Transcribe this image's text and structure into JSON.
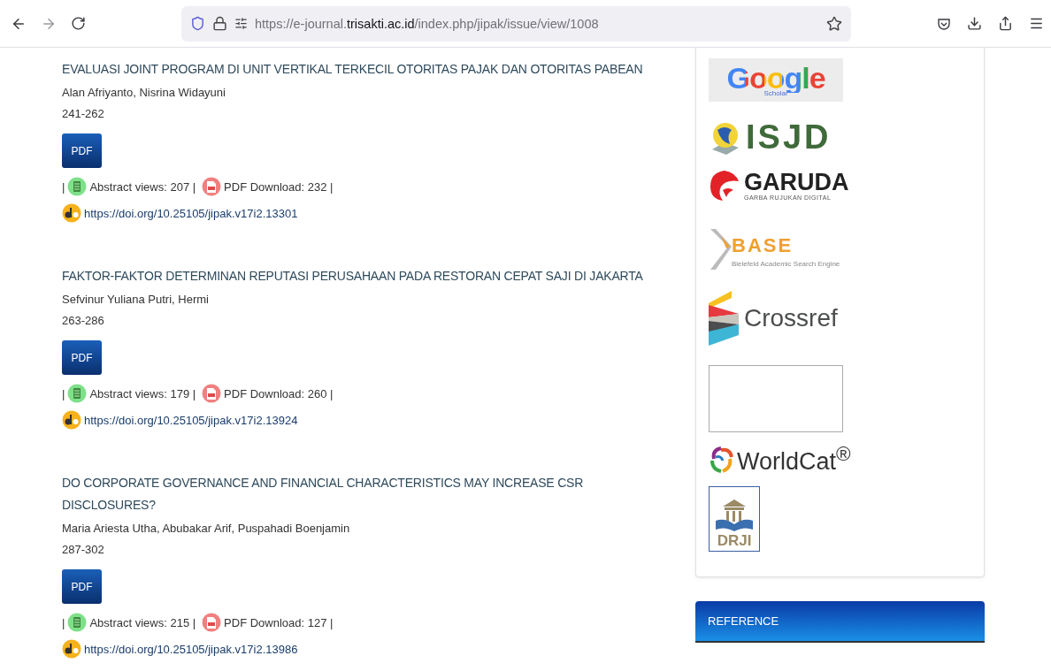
{
  "browser": {
    "url_segments": [
      {
        "text": "https://e-journal.",
        "emphasis": false
      },
      {
        "text": "trisakti.ac.id",
        "emphasis": true
      },
      {
        "text": "/index.php/jipak/issue/view/1008",
        "emphasis": false
      }
    ]
  },
  "articles": [
    {
      "title": "EVALUASI JOINT PROGRAM DI UNIT VERTIKAL TERKECIL OTORITAS PAJAK DAN OTORITAS PABEAN",
      "authors": "Alan Afriyanto, Nisrina Widayuni",
      "pages": "241-262",
      "galley": "PDF",
      "stats_lead": "|",
      "abstract_views": "Abstract views: 207 |",
      "pdf_downloads": "PDF Download: 232 |",
      "doi": "https://doi.org/10.25105/jipak.v17i2.13301"
    },
    {
      "title": "FAKTOR-FAKTOR DETERMINAN REPUTASI PERUSAHAAN PADA RESTORAN CEPAT SAJI DI JAKARTA",
      "authors": "Sefvinur Yuliana Putri, Hermi",
      "pages": "263-286",
      "galley": "PDF",
      "stats_lead": "|",
      "abstract_views": "Abstract views: 179 |",
      "pdf_downloads": "PDF Download: 260 |",
      "doi": "https://doi.org/10.25105/jipak.v17i2.13924"
    },
    {
      "title": "DO CORPORATE GOVERNANCE AND FINANCIAL CHARACTERISTICS MAY INCREASE CSR DISCLOSURES?",
      "authors": "Maria Ariesta Utha, Abubakar Arif, Puspahadi Boenjamin",
      "pages": "287-302",
      "galley": "PDF",
      "stats_lead": "|",
      "abstract_views": "Abstract views: 215 |",
      "pdf_downloads": "PDF Download: 127 |",
      "doi": "https://doi.org/10.25105/jipak.v17i2.13986"
    }
  ],
  "sidebar": {
    "indexing": [
      {
        "kind": "google",
        "text": "Google",
        "sub": "Scholar"
      },
      {
        "kind": "isjd",
        "text": "ISJD"
      },
      {
        "kind": "garuda",
        "text": "GARUDA",
        "sub": "GARBA RUJUKAN DIGITAL"
      },
      {
        "kind": "base",
        "text": "BASE",
        "sub": "Bielefeld Academic Search Engine"
      },
      {
        "kind": "crossref",
        "text": "Crossref"
      },
      {
        "kind": "blank"
      },
      {
        "kind": "worldcat",
        "text": "WorldCat$^{®}$"
      },
      {
        "kind": "drji",
        "text": "DRJI"
      }
    ],
    "reference": {
      "title": "REFERENCE"
    }
  }
}
